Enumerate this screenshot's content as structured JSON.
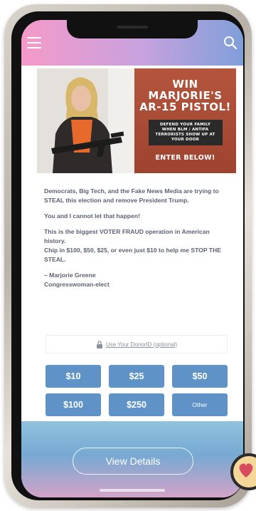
{
  "header": {
    "menu_icon": "hamburger-icon",
    "search_icon": "search-icon"
  },
  "hero": {
    "promo_lines": [
      "WIN",
      "MARJORIE'S",
      "AR-15 PISTOL!"
    ],
    "promo_sub": "DEFEND YOUR FAMILY WHEN BLM / ANTIFA TERRORISTS SHOW UP AT YOUR DOOR",
    "promo_cta": "ENTER BELOW!"
  },
  "message": {
    "p1": "Democrats, Big Tech, and the Fake News Media are trying to STEAL this election and remove President Trump.",
    "p2": "You and I cannot let that happen!",
    "p3": "This is the biggest VOTER FRAUD operation in American history.",
    "p4": "Chip in $100, $50, $25, or even just $10 to help me STOP THE STEAL.",
    "sig_name": "– Marjorie Greene",
    "sig_title": "Congresswoman-elect"
  },
  "donor_id": {
    "label": "Use Your DonorID (optional)",
    "icon": "lock-icon"
  },
  "amounts": [
    "$10",
    "$25",
    "$50",
    "$100",
    "$250",
    "Other"
  ],
  "footer": {
    "view_details_label": "View Details"
  },
  "colors": {
    "header_gradient": [
      "#f59ac9",
      "#c7a2de",
      "#7f9fd9"
    ],
    "amount_button": "#5f93c7",
    "body_text": "#5b6272",
    "promo_bg": "#b4553d"
  }
}
